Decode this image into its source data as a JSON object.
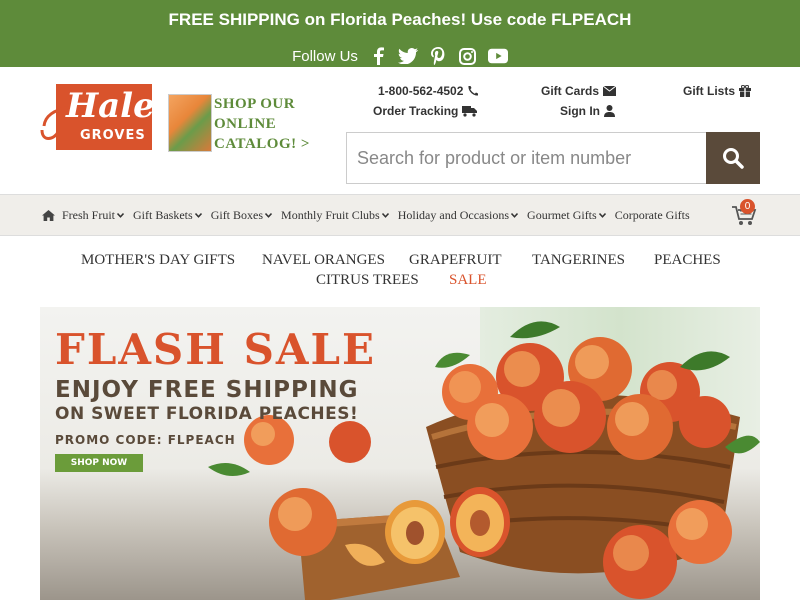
{
  "promo_bar": {
    "message": "FREE SHIPPING on Florida Peaches! Use code FLPEACH",
    "follow_label": "Follow Us",
    "social": [
      "facebook-icon",
      "twitter-icon",
      "pinterest-icon",
      "instagram-icon",
      "youtube-icon"
    ]
  },
  "logo": {
    "line1": "Hale",
    "line2": "GROVES"
  },
  "catalog": {
    "line1": "SHOP OUR",
    "line2": "ONLINE",
    "line3": "CATALOG! >"
  },
  "utility": {
    "phone": "1-800-562-4502",
    "order_tracking": "Order Tracking",
    "gift_cards": "Gift Cards",
    "sign_in": "Sign In",
    "gift_lists": "Gift Lists"
  },
  "search": {
    "placeholder": "Search for product or item number"
  },
  "nav": {
    "items": [
      "Fresh Fruit",
      "Gift Baskets",
      "Gift Boxes",
      "Monthly Fruit Clubs",
      "Holiday and Occasions",
      "Gourmet Gifts",
      "Corporate Gifts"
    ],
    "cart_count": "0"
  },
  "subnav": {
    "items": [
      "MOTHER'S DAY GIFTS",
      "NAVEL ORANGES",
      "GRAPEFRUIT",
      "TANGERINES",
      "PEACHES",
      "CITRUS TREES",
      "SALE"
    ]
  },
  "hero": {
    "title": "FLASH SALE",
    "sub1": "ENJOY FREE SHIPPING",
    "sub2": "ON SWEET FLORIDA PEACHES!",
    "promo": "PROMO CODE: FLPEACH",
    "button": "SHOP NOW"
  },
  "colors": {
    "green": "#5e8b3a",
    "orange_red": "#d9532c",
    "brown": "#5a4a3a"
  }
}
